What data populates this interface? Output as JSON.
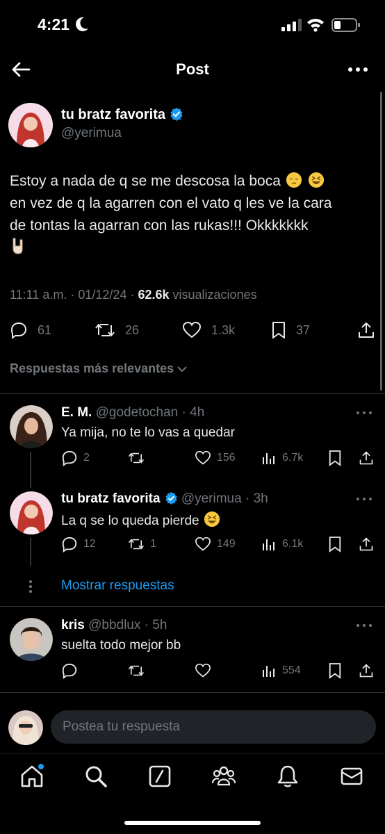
{
  "status_bar": {
    "time": "4:21"
  },
  "header": {
    "title": "Post"
  },
  "post": {
    "author_name": "tu bratz favorita",
    "author_handle": "@yerimua",
    "body_line1": "Estoy a nada de q se me descosa la boca",
    "body_line2": "en vez de q la agarren con el vato q les ve la cara",
    "body_line3": "de tontas la agarran con las rukas!!! Okkkkkkk",
    "time": "11:11 a.m.",
    "date": "01/12/24",
    "views_count": "62.6k",
    "views_label": "visualizaciones",
    "replies": "61",
    "reposts": "26",
    "likes": "1.3k",
    "bookmarks": "37"
  },
  "sort_label": "Respuestas más relevantes",
  "replies": [
    {
      "name": "E. M.",
      "handle": "@godetochan",
      "age": "4h",
      "text": "Ya mija, no te lo vas a quedar",
      "replies": "2",
      "reposts": "",
      "likes": "156",
      "views": "6.7k"
    },
    {
      "name": "tu bratz favorita",
      "handle": "@yerimua",
      "age": "3h",
      "text": "La q se lo queda pierde",
      "replies": "12",
      "reposts": "1",
      "likes": "149",
      "views": "6.1k"
    },
    {
      "name": "kris",
      "handle": "@bbdlux",
      "age": "5h",
      "text": "suelta todo mejor bb",
      "replies": "",
      "reposts": "",
      "likes": "",
      "views": "554"
    }
  ],
  "show_replies_label": "Mostrar respuestas",
  "compose": {
    "placeholder": "Postea tu respuesta"
  },
  "icons": {
    "back": "arrow-left-icon",
    "more": "more-horizontal-icon",
    "verified": "verified-badge-icon",
    "reply": "reply-icon",
    "repost": "repost-icon",
    "like": "heart-icon",
    "bookmark": "bookmark-icon",
    "share": "share-icon",
    "views": "views-icon",
    "home": "home-icon",
    "search": "search-icon",
    "grok": "grok-icon",
    "communities": "communities-icon",
    "notifications": "bell-icon",
    "messages": "mail-icon"
  },
  "colors": {
    "accent": "#1d9bf0",
    "background": "#000000",
    "muted": "#71767b"
  }
}
